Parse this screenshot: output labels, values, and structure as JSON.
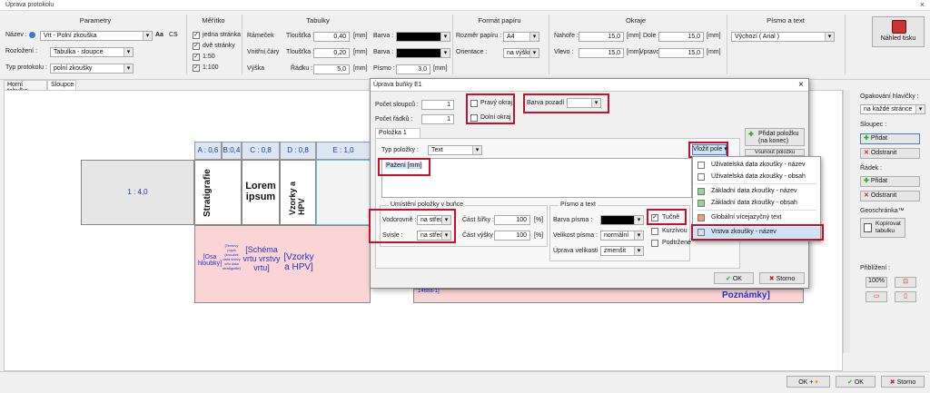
{
  "window": {
    "title": "Úprava protokolu",
    "close": "×"
  },
  "parametry": {
    "title": "Parametry",
    "nazev_label": "Název :",
    "nazev_value": "Vrt - Polní zkouška",
    "nazev_icon": "Aa",
    "nazev_lang": "CS",
    "rozlozeni_label": "Rozložení :",
    "rozlozeni_value": "Tabulka - sloupce",
    "typ_label": "Typ protokolu :",
    "typ_value": "polní zkoušky"
  },
  "meritko": {
    "title": "Měřítko",
    "opt1": "jedna stránka",
    "opt2": "dvě stránky",
    "opt3": "1:50",
    "opt4": "1:100"
  },
  "tabulky": {
    "title": "Tabulky",
    "ramecek": "Rámeček",
    "vnitrni": "Vnitřní čáry",
    "vyska": "Výška",
    "tloustka1_label": "Tloušťka :",
    "tloustka1_value": "0,40",
    "tloustka2_label": "Tloušťka :",
    "tloustka2_value": "0,20",
    "radku_label": "Řádku :",
    "radku_value": "5,0",
    "unit": "[mm]",
    "barva1_label": "Barva :",
    "barva2_label": "Barva :",
    "pismo_label": "Písmo :",
    "pismo_value": "3,0"
  },
  "format": {
    "title": "Formát papíru",
    "rozmer_label": "Rozměr papíru :",
    "rozmer_value": "A4",
    "orient_label": "Orientace :",
    "orient_value": "na výšku"
  },
  "okraje": {
    "title": "Okraje",
    "nahore_label": "Nahoře :",
    "nahore_value": "15,0",
    "dole_label": "Dole :",
    "dole_value": "15,0",
    "vlevo_label": "Vlevo :",
    "vlevo_value": "15,0",
    "vpravo_label": "Vpravo :",
    "vpravo_value": "15,0",
    "unit": "[mm]"
  },
  "pismo": {
    "title": "Písmo a text",
    "value": "Výchozí ( Arial )"
  },
  "nahled": {
    "label": "Náhled tisku",
    "icon": "printer-icon"
  },
  "tabs": [
    "Horní tabulka",
    "Sloupce"
  ],
  "sheet": {
    "cols": [
      "A : 0,6",
      "B:0,4",
      "C : 0,8",
      "D : 0,8",
      "E : 1,0"
    ],
    "row_label": "1 : 4,0",
    "cell_strat": "Stratigrafie",
    "cell_lorem": "Lorem ipsum",
    "cell_vzorky": "Vzorky a HPV",
    "p_osa": "[Osa hloubky]",
    "p_small": "[Textový popis (kroužek data vrstvy vrtu data stratigrafie]",
    "p_schema": "[Schéma vrtu vrstvy vrtu]",
    "p_vzorky": "[Vzorky a HPV]",
    "p_poznamky": "Poznámky]",
    "p_code": "14688-1]"
  },
  "right_panel": {
    "opakovani_label": "Opakování hlavičky :",
    "opakovani_value": "na každé stránce",
    "sloupec_label": "Sloupec :",
    "pridat": "Přidat",
    "odstranit": "Odstranit",
    "radek_label": "Řádek :",
    "pridat2": "Přidat",
    "odstranit2": "Odstranit",
    "geo_label": "Geoschránka™",
    "kopirovat": "Kopírovat tabulku",
    "priblizeni_label": "Přiblížení :",
    "zoom": "100%"
  },
  "dialog": {
    "title": "Úprava buňky E1",
    "close": "×",
    "pocet_sloupcu_label": "Počet sloupců :",
    "pocet_sloupcu": "1",
    "pocet_radku_label": "Počet řádků :",
    "pocet_radku": "1",
    "pravy_okraj": "Pravý okraj",
    "dolni_okraj": "Dolní okraj",
    "barva_pozadi_label": "Barva pozadí :",
    "polozka_tab": "Položka 1",
    "pridat_polozku": "Přidat položku (na konec)",
    "vsunout_polozku": "Vsunout položku",
    "typ_polozky_label": "Typ položky :",
    "typ_polozky": "Text",
    "vlozit_pole": "Vložit pole",
    "text_field": "Pažení [mm]",
    "umisteni_title": "Umístění položky v buňce",
    "vodorovne_label": "Vodorovně :",
    "vodorovne": "na střed",
    "svisle_label": "Svisle :",
    "svisle": "na střed",
    "cast_sirky_label": "Část šířky :",
    "cast_sirky": "100",
    "cast_vysky_label": "Část výšky :",
    "cast_vysky": "100",
    "pct": "[%]",
    "pismo_title": "Písmo a text",
    "barva_pisma_label": "Barva písma :",
    "velikost_label": "Velikost písma :",
    "velikost": "normální",
    "uprava_label": "Úprava velikosti :",
    "uprava": "zmenšit",
    "tucne": "Tučně",
    "kurzivou": "Kurzívou",
    "podtrzene": "Podtržené",
    "ok": "OK",
    "storno": "Storno"
  },
  "menu": [
    {
      "label": "Uživatelská data zkoušky - název",
      "color": "#ffffff"
    },
    {
      "label": "Uživatelská data zkoušky - obsah",
      "color": "#ffffff"
    },
    {
      "label": "Základní data zkoušky - název",
      "color": "#90d890"
    },
    {
      "label": "Základní data zkoušky - obsah",
      "color": "#90d890"
    },
    {
      "label": "Globální vícejazyčný text",
      "color": "#f0a070"
    },
    {
      "label": "Vrstva zkoušky - název",
      "color": "#cfe3f7"
    }
  ],
  "footer": {
    "ok_plus": "OK +",
    "ok": "OK",
    "storno": "Storno"
  }
}
